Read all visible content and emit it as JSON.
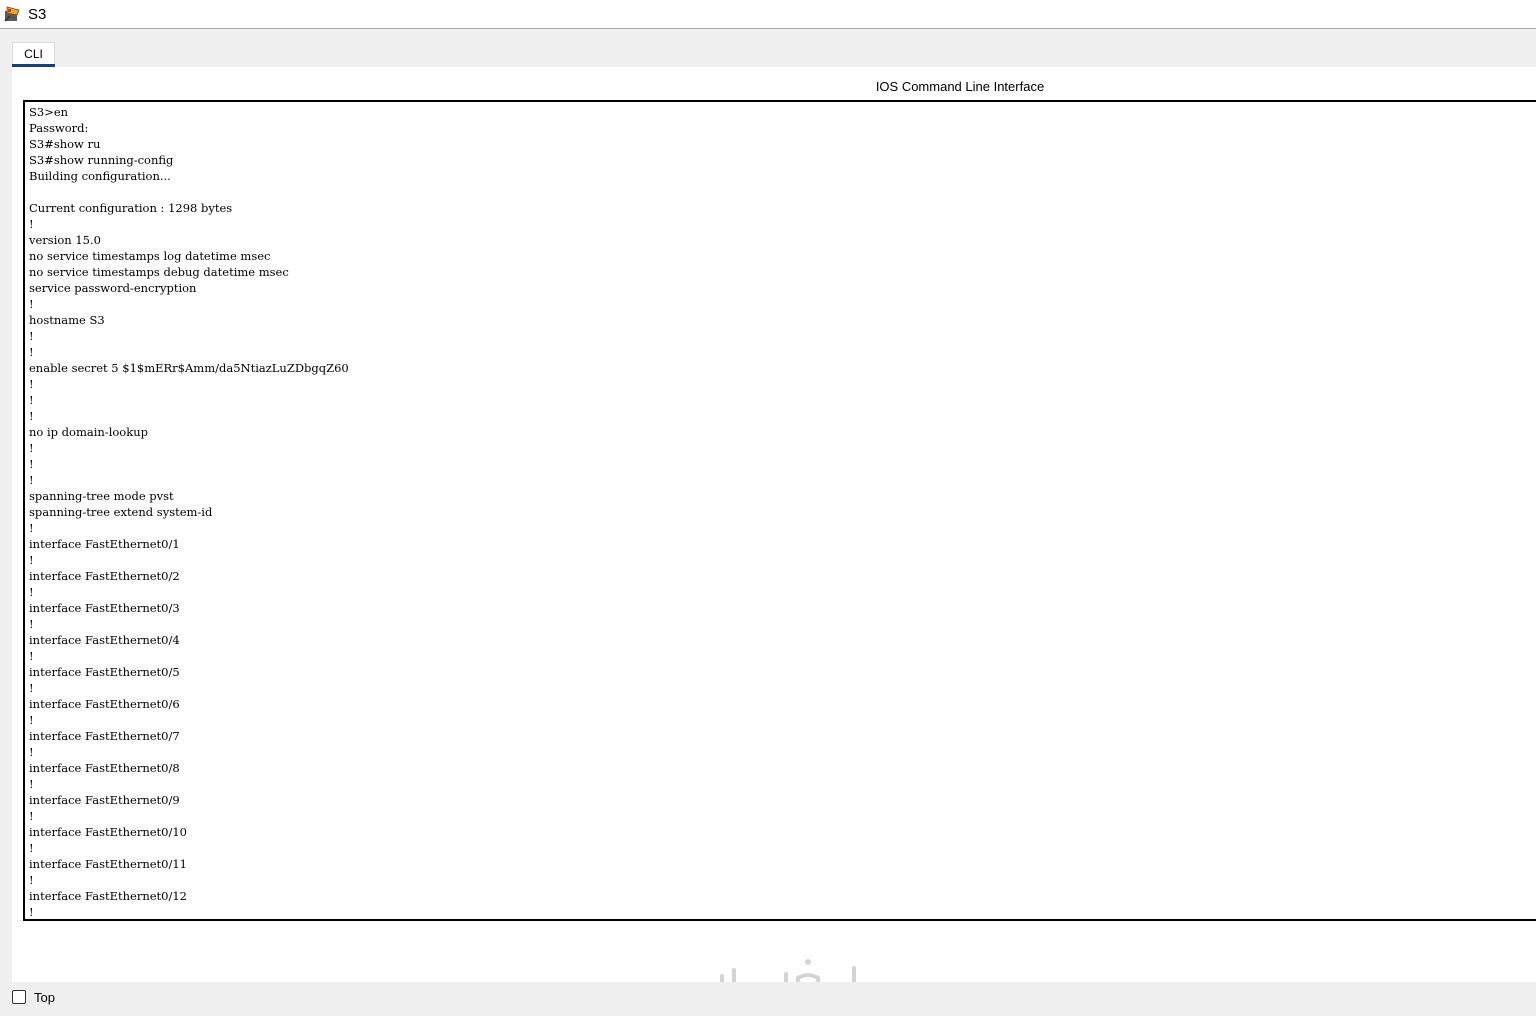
{
  "window": {
    "title": "S3",
    "icon": "packet-tracer-switch-icon"
  },
  "tabs": [
    {
      "label": "CLI",
      "active": true
    }
  ],
  "cli": {
    "heading": "IOS Command Line Interface",
    "output": "S3>en\nPassword:\nS3#show ru\nS3#show running-config\nBuilding configuration...\n\nCurrent configuration : 1298 bytes\n!\nversion 15.0\nno service timestamps log datetime msec\nno service timestamps debug datetime msec\nservice password-encryption\n!\nhostname S3\n!\n!\nenable secret 5 $1$mERr$Amm/da5NtiazLuZDbgqZ60\n!\n!\n!\nno ip domain-lookup\n!\n!\n!\nspanning-tree mode pvst\nspanning-tree extend system-id\n!\ninterface FastEthernet0/1\n!\ninterface FastEthernet0/2\n!\ninterface FastEthernet0/3\n!\ninterface FastEthernet0/4\n!\ninterface FastEthernet0/5\n!\ninterface FastEthernet0/6\n!\ninterface FastEthernet0/7\n!\ninterface FastEthernet0/8\n!\ninterface FastEthernet0/9\n!\ninterface FastEthernet0/10\n!\ninterface FastEthernet0/11\n!\ninterface FastEthernet0/12\n!"
  },
  "footer": {
    "top_label": "Top",
    "top_checked": false
  },
  "watermark": {
    "text": "خمسات"
  },
  "colors": {
    "tab_underline": "#1c3f6e",
    "background": "#f0f0f0",
    "terminal_border": "#000000"
  }
}
